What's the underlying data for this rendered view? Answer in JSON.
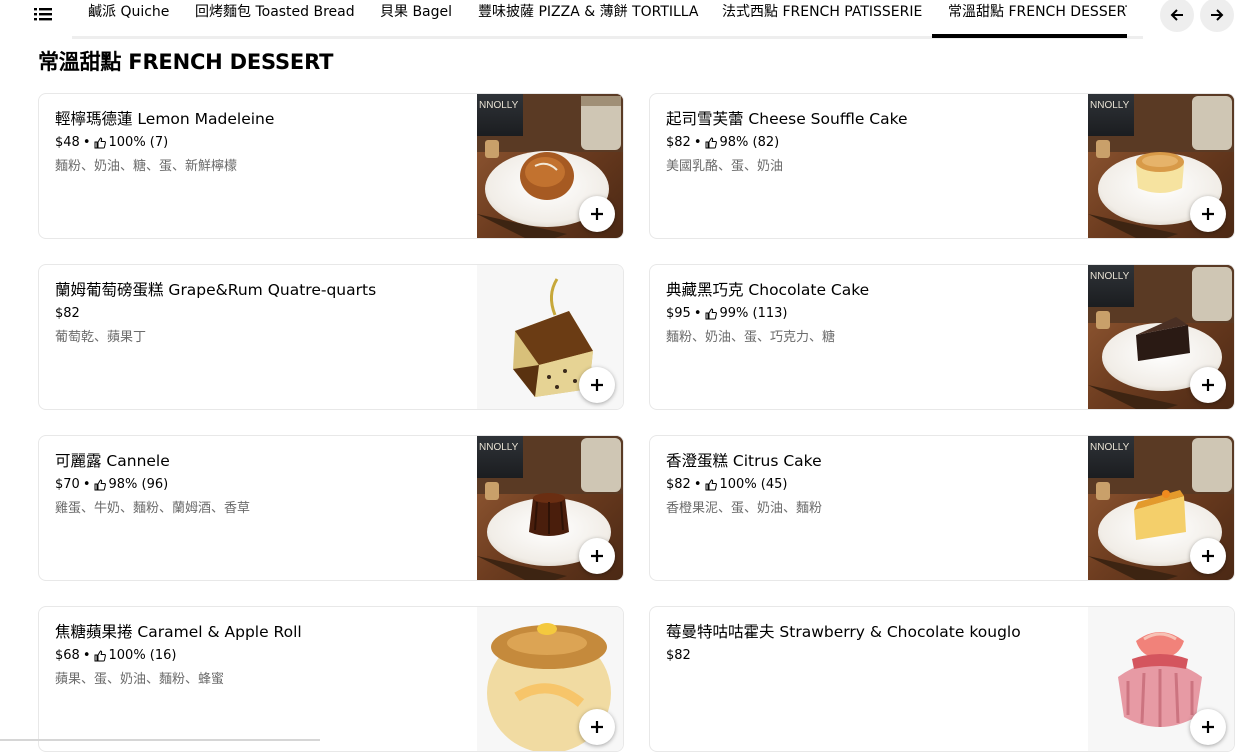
{
  "nav": {
    "tabs": [
      {
        "label": "鹹派 Quiche"
      },
      {
        "label": "回烤麵包 Toasted Bread"
      },
      {
        "label": "貝果 Bagel"
      },
      {
        "label": "豐味披薩 PIZZA & 薄餅 TORTILLA"
      },
      {
        "label": "法式西點 FRENCH PATISSERIE"
      },
      {
        "label": "常溫甜點 FRENCH DESSERT",
        "active": true
      }
    ],
    "menu_icon": "hamburger-menu-icon",
    "prev_icon": "arrow-left-icon",
    "next_icon": "arrow-right-icon"
  },
  "section": {
    "title": "常溫甜點 FRENCH DESSERT"
  },
  "items": [
    {
      "name": "輕檸瑪德蓮 Lemon Madeleine",
      "price": "$48",
      "rating": "100% (7)",
      "description": "麵粉、奶油、糖、蛋、新鮮檸檬",
      "photo": "madeleine"
    },
    {
      "name": "起司雪芙蕾 Cheese Souffle Cake",
      "price": "$82",
      "rating": "98% (82)",
      "description": "美國乳酪、蛋、奶油",
      "photo": "souffle"
    },
    {
      "name": "蘭姆葡萄磅蛋糕 Grape&Rum Quatre-quarts",
      "price": "$82",
      "rating": "",
      "description": "葡萄乾、蘋果丁",
      "photo": "poundcake"
    },
    {
      "name": "典藏黑巧克 Chocolate Cake",
      "price": "$95",
      "rating": "99% (113)",
      "description": "麵粉、奶油、蛋、巧克力、糖",
      "photo": "chocolate"
    },
    {
      "name": "可麗露 Cannele",
      "price": "$70",
      "rating": "98% (96)",
      "description": "雞蛋、牛奶、麵粉、蘭姆酒、香草",
      "photo": "cannele"
    },
    {
      "name": "香澄蛋糕 Citrus Cake",
      "price": "$82",
      "rating": "100% (45)",
      "description": "香橙果泥、蛋、奶油、麵粉",
      "photo": "citrus"
    },
    {
      "name": "焦糖蘋果捲 Caramel & Apple Roll",
      "price": "$68",
      "rating": "100% (16)",
      "description": "蘋果、蛋、奶油、麵粉、蜂蜜",
      "photo": "roll"
    },
    {
      "name": "莓曼特咕咕霍夫 Strawberry & Chocolate kouglo",
      "price": "$82",
      "rating": "",
      "description": "",
      "photo": "kouglof"
    }
  ],
  "colors": {
    "text_primary": "#000000",
    "text_secondary": "#6b6b6b",
    "card_border": "#e8e8e8",
    "wood": "#7a4a2a",
    "plate": "#f4f1ec"
  },
  "icons": {
    "thumbs_up": "thumbs-up-icon",
    "add": "plus-icon"
  }
}
